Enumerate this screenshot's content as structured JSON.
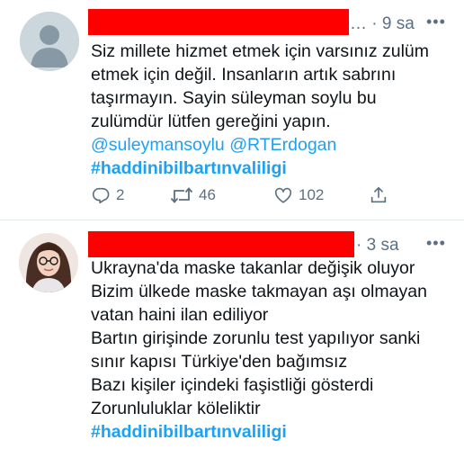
{
  "tweets": [
    {
      "time": "9 sa",
      "lines": [
        "Siz millete hizmet etmek için varsınız zulüm",
        "etmek için değil. Insanların artık sabrını",
        "taşırmayın. Sayin süleyman soylu bu",
        "zulümdür lütfen gereğini yapın."
      ],
      "mentions": [
        "@suleymansoylu",
        "@RTErdogan"
      ],
      "hashtag": "#haddinibilbartınvaliligi",
      "actions": {
        "reply": "2",
        "retweet": "46",
        "like": "102"
      }
    },
    {
      "time": "3 sa",
      "lines": [
        "Ukrayna'da maske takanlar değişik oluyor",
        "Bizim ülkede maske takmayan aşı olmayan",
        "vatan haini ilan ediliyor",
        "Bartın girişinde zorunlu test yapılıyor sanki",
        "sınır kapısı Türkiye'den bağımsız",
        "Bazı kişiler içindeki faşistliği gösterdi",
        "Zorunluluklar köleliktir"
      ],
      "hashtag": "#haddinibilbartınvaliligi"
    }
  ],
  "colors": {
    "link": "#1da1f2",
    "muted": "#5b7083",
    "redaction": "#ff0000",
    "divider": "#e1e8ed"
  },
  "icons": [
    "reply-icon",
    "retweet-icon",
    "like-icon",
    "share-icon",
    "more-icon",
    "default-avatar-icon"
  ]
}
